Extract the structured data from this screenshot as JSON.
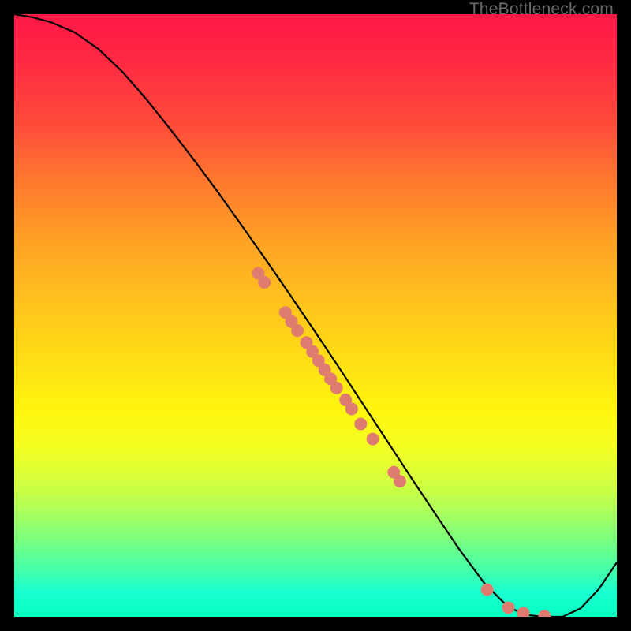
{
  "watermark": "TheBottleneck.com",
  "chart_data": {
    "type": "line",
    "title": "",
    "xlabel": "",
    "ylabel": "",
    "xlim": [
      0,
      100
    ],
    "ylim": [
      0,
      100
    ],
    "grid": false,
    "legend": false,
    "series": [
      {
        "name": "curve",
        "x": [
          0,
          3,
          6,
          10,
          14,
          18,
          22,
          26,
          30,
          34,
          38,
          42,
          46,
          50,
          54,
          58,
          62,
          66,
          70,
          74,
          78,
          82,
          85,
          88,
          91,
          94,
          97,
          100
        ],
        "y": [
          100,
          99.5,
          98.7,
          97.0,
          94.2,
          90.4,
          85.8,
          80.8,
          75.6,
          70.2,
          64.6,
          58.9,
          53.1,
          47.2,
          41.2,
          35.1,
          29.0,
          22.9,
          16.9,
          11.0,
          5.6,
          1.6,
          0.3,
          0.0,
          0.0,
          1.4,
          4.6,
          9.0
        ]
      }
    ],
    "scatter_points": {
      "name": "highlighted-points",
      "color": "#e07b6f",
      "radius_px": 8,
      "points": [
        {
          "x": 40.5,
          "y": 57.0
        },
        {
          "x": 41.5,
          "y": 55.5
        },
        {
          "x": 45.0,
          "y": 50.5
        },
        {
          "x": 46.0,
          "y": 49.0
        },
        {
          "x": 47.0,
          "y": 47.5
        },
        {
          "x": 48.5,
          "y": 45.5
        },
        {
          "x": 49.5,
          "y": 44.0
        },
        {
          "x": 50.5,
          "y": 42.5
        },
        {
          "x": 51.5,
          "y": 41.0
        },
        {
          "x": 52.5,
          "y": 39.5
        },
        {
          "x": 53.5,
          "y": 38.0
        },
        {
          "x": 55.0,
          "y": 36.0
        },
        {
          "x": 56.0,
          "y": 34.5
        },
        {
          "x": 57.5,
          "y": 32.0
        },
        {
          "x": 59.5,
          "y": 29.5
        },
        {
          "x": 63.0,
          "y": 24.0
        },
        {
          "x": 64.0,
          "y": 22.5
        },
        {
          "x": 78.5,
          "y": 4.5
        },
        {
          "x": 82.0,
          "y": 1.5
        },
        {
          "x": 84.5,
          "y": 0.6
        },
        {
          "x": 88.0,
          "y": 0.1
        }
      ]
    },
    "background_gradient": {
      "direction": "vertical",
      "stops": [
        {
          "pos": 0.0,
          "color": "#ff1846"
        },
        {
          "pos": 0.5,
          "color": "#ffd618"
        },
        {
          "pos": 0.75,
          "color": "#eaff2a"
        },
        {
          "pos": 1.0,
          "color": "#06ffc0"
        }
      ]
    }
  }
}
